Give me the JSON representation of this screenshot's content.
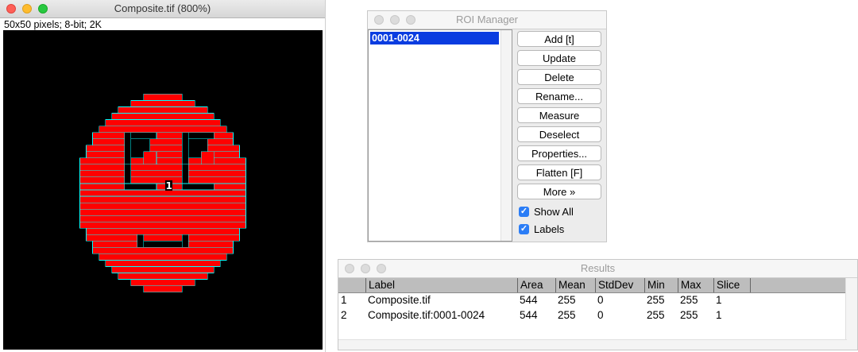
{
  "image_window": {
    "title": "Composite.tif (800%)",
    "info": "50x50 pixels; 8-bit; 2K",
    "roi_label": "1",
    "colors": {
      "face": "#ff0000",
      "background": "#000000",
      "outline": "#00ffff"
    }
  },
  "roi_manager": {
    "title": "ROI Manager",
    "list_items": [
      "0001-0024"
    ],
    "buttons": [
      "Add [t]",
      "Update",
      "Delete",
      "Rename...",
      "Measure",
      "Deselect",
      "Properties...",
      "Flatten [F]",
      "More »"
    ],
    "checkboxes": [
      {
        "label": "Show All",
        "checked": true
      },
      {
        "label": "Labels",
        "checked": true
      }
    ]
  },
  "results": {
    "title": "Results",
    "columns": [
      "",
      "Label",
      "Area",
      "Mean",
      "StdDev",
      "Min",
      "Max",
      "Slice"
    ],
    "rows": [
      [
        "1",
        "Composite.tif",
        "544",
        "255",
        "0",
        "255",
        "255",
        "1"
      ],
      [
        "2",
        "Composite.tif:0001-0024",
        "544",
        "255",
        "0",
        "255",
        "255",
        "1"
      ]
    ]
  }
}
